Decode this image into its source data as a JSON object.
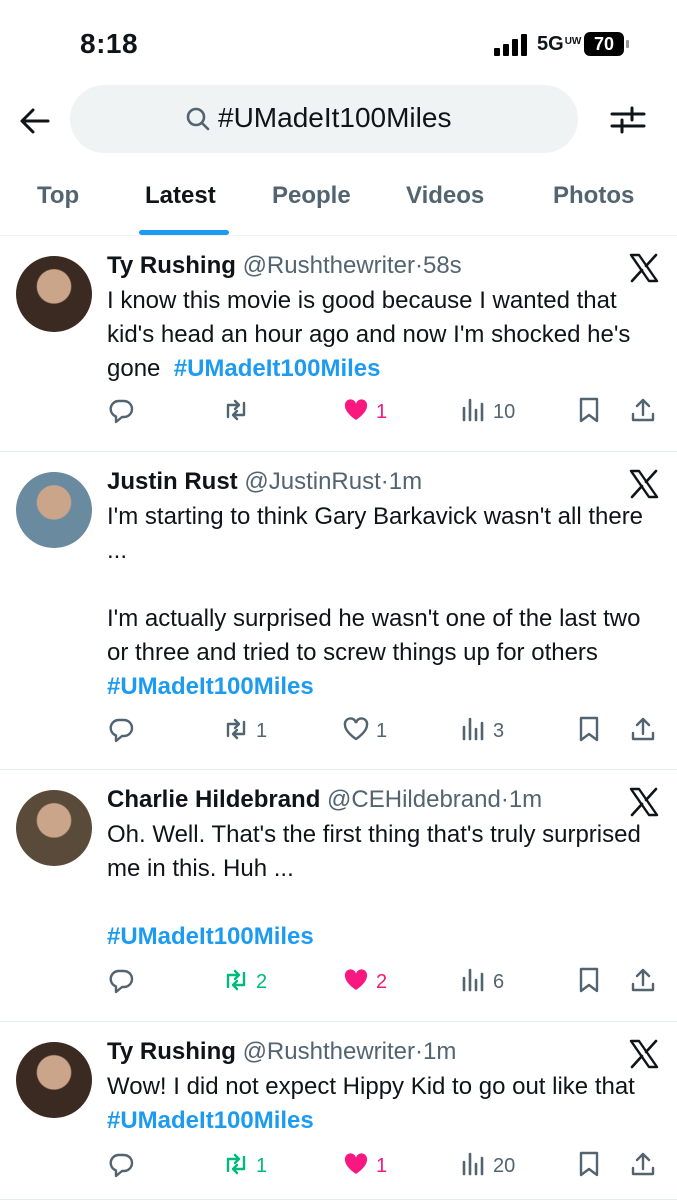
{
  "status": {
    "time": "8:18",
    "network": "5G",
    "network_sub": "UW",
    "battery": "70"
  },
  "search": {
    "query": "#UMadeIt100Miles"
  },
  "tabs": [
    {
      "label": "Top"
    },
    {
      "label": "Latest"
    },
    {
      "label": "People"
    },
    {
      "label": "Videos"
    },
    {
      "label": "Photos"
    }
  ],
  "tweets": [
    {
      "name": "Ty Rushing",
      "handle": "@Rushthewriter",
      "time": "58s",
      "text": "I know this movie is good because I wanted that kid's head an hour ago and now I'm shocked he's gone  ",
      "tag": "#UMadeIt100Miles",
      "replies": "",
      "retweets": "",
      "likes": "1",
      "views": "10",
      "liked": true,
      "retweeted": false
    },
    {
      "name": "Justin Rust",
      "handle": "@JustinRust",
      "time": "1m",
      "text": "I'm starting to think Gary Barkavick wasn't all there ...\n\nI'm actually surprised he wasn't one of the last two or three and tried to screw things up for others ",
      "tag": "#UMadeIt100Miles",
      "replies": "",
      "retweets": "1",
      "likes": "1",
      "views": "3",
      "liked": false,
      "retweeted": false
    },
    {
      "name": "Charlie Hildebrand",
      "handle": "@CEHildebrand",
      "time": "1m",
      "text": "Oh. Well. That's the first thing that's truly surprised me in this. Huh ...\n\n",
      "tag": "#UMadeIt100Miles",
      "replies": "",
      "retweets": "2",
      "likes": "2",
      "views": "6",
      "liked": true,
      "retweeted": true
    },
    {
      "name": "Ty Rushing",
      "handle": "@Rushthewriter",
      "time": "1m",
      "text": "Wow! I did not expect Hippy Kid to go out like that ",
      "tag": "#UMadeIt100Miles",
      "replies": "",
      "retweets": "1",
      "likes": "1",
      "views": "20",
      "liked": true,
      "retweeted": true
    }
  ],
  "colors": {
    "accent": "#1d9bf0",
    "like": "#f91880",
    "retweet": "#00ba7c",
    "muted": "#536471"
  }
}
